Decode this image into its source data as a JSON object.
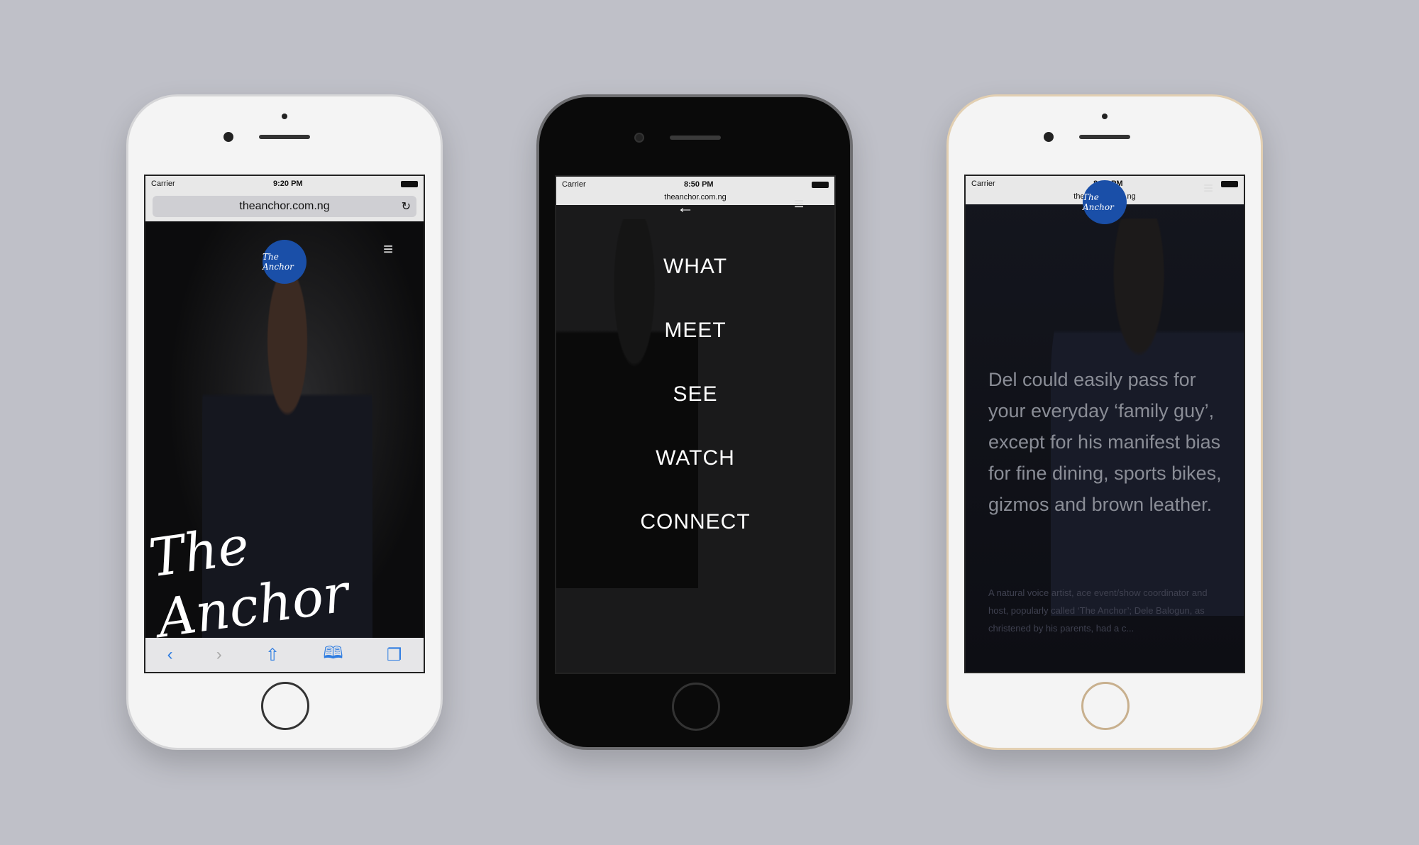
{
  "phones": [
    {
      "carrier": "Carrier",
      "time": "9:20 PM",
      "url": "theanchor.com.ng",
      "logo_text": "The Anchor",
      "hero_text": "The Anchor",
      "toolbar": [
        "back-icon",
        "forward-icon",
        "share-icon",
        "bookmarks-icon",
        "tabs-icon"
      ]
    },
    {
      "carrier": "Carrier",
      "time": "8:50 PM",
      "url": "theanchor.com.ng",
      "menu": [
        "WHAT",
        "MEET",
        "SEE",
        "WATCH",
        "CONNECT"
      ]
    },
    {
      "carrier": "Carrier",
      "time": "8:51 PM",
      "url": "theanchor.com.ng",
      "bio": "Del could easily pass for your everyday ‘family guy’, except for his manifest bias for fine dining, sports bikes, gizmos and brown leather.",
      "small": "A natural voice artist, ace event/show coordinator and host, popularly called ‘The Anchor’; Dele Balogun, as christened by his parents, had a c..."
    }
  ],
  "colors": {
    "background": "#bfc0c8",
    "logo": "#1a4fa8",
    "ios_blue": "#2f7de1"
  }
}
